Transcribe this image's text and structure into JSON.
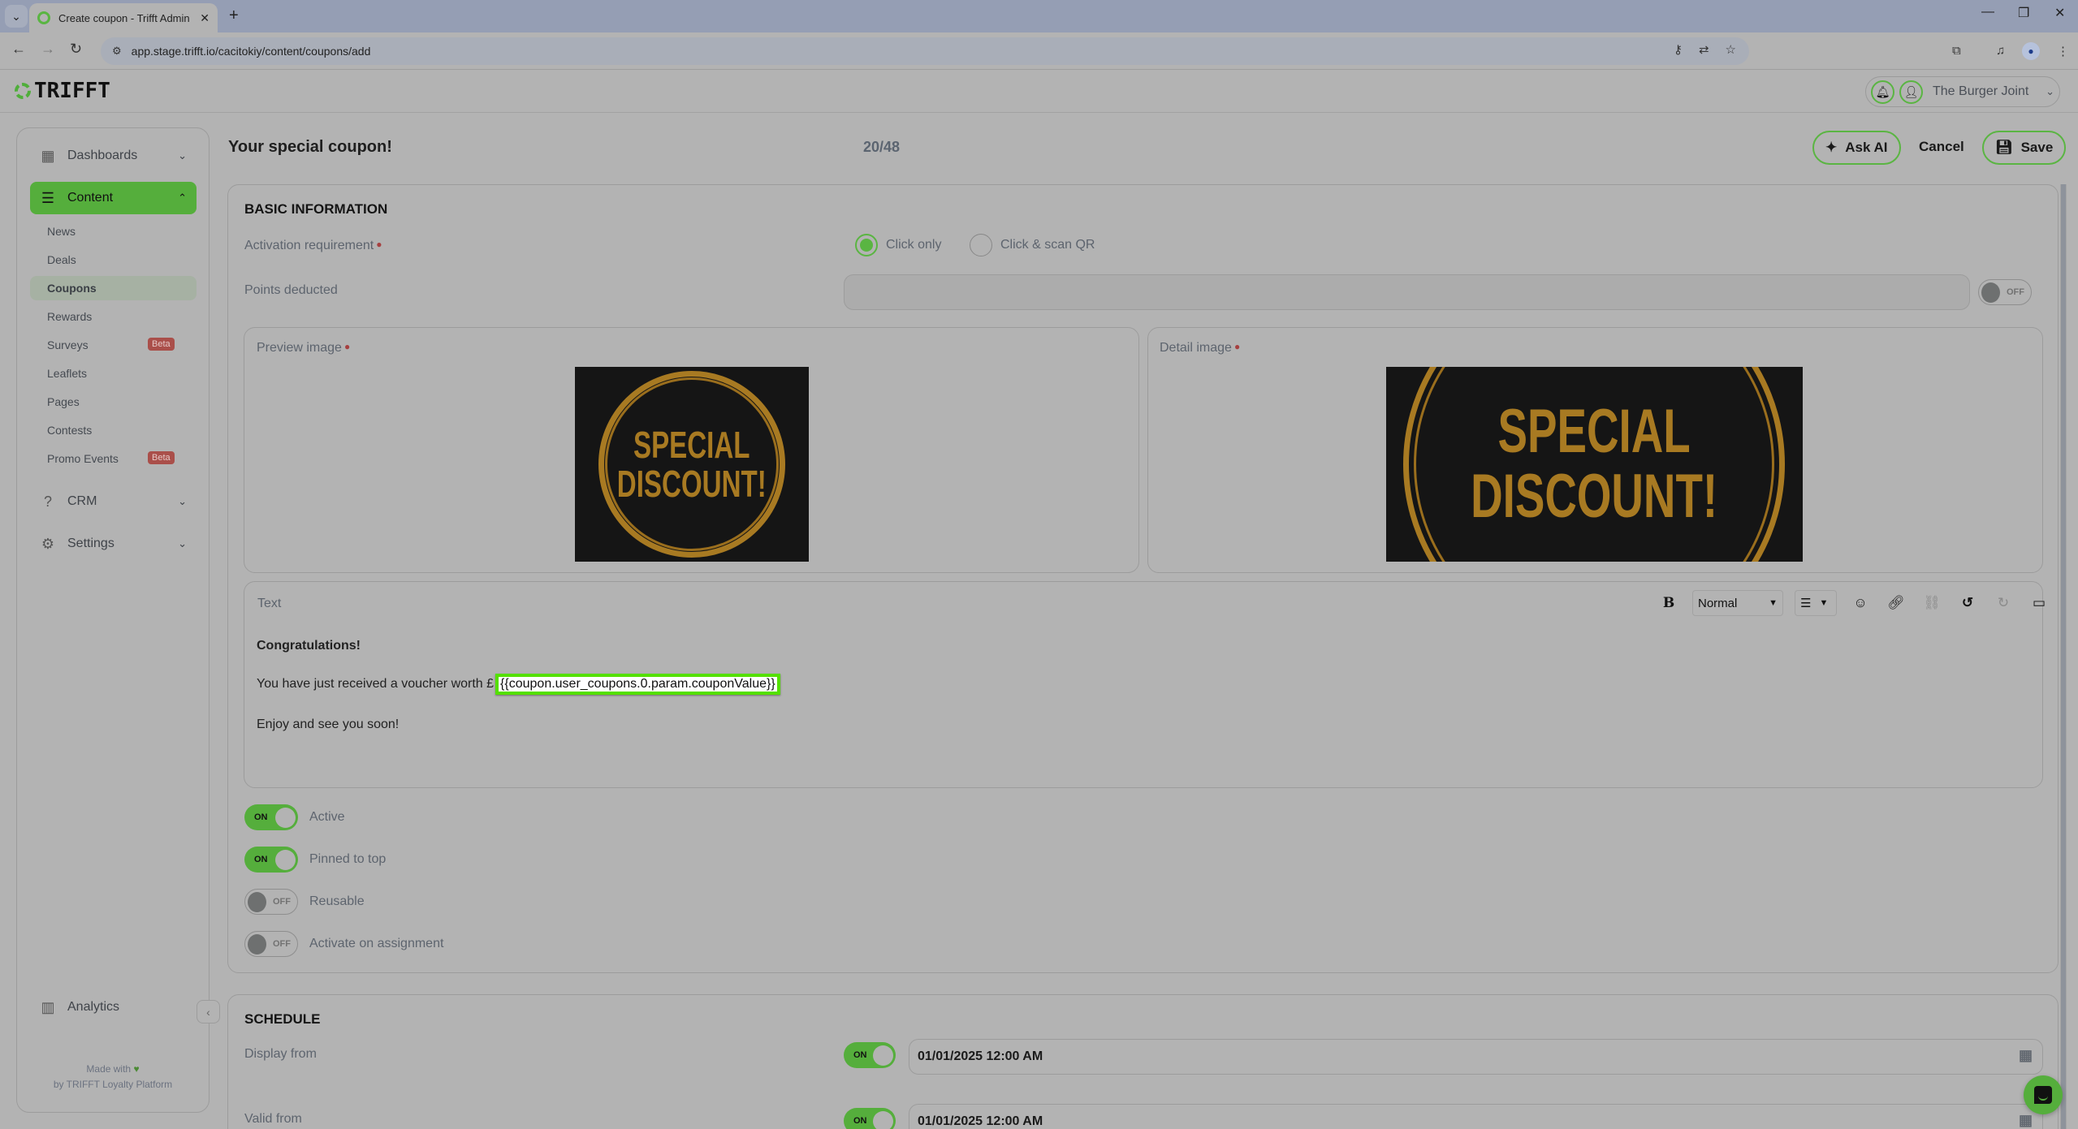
{
  "browser": {
    "tab_title": "Create coupon - Trifft Admin",
    "url": "app.stage.trifft.io/cacitokiy/content/coupons/add"
  },
  "header": {
    "logo_text": "TRIFFT",
    "account_name": "The Burger Joint"
  },
  "sidebar": {
    "groups": [
      {
        "label": "Dashboards",
        "icon": "dashboard-icon",
        "expanded": false
      },
      {
        "label": "Content",
        "icon": "document-icon",
        "expanded": true,
        "active": true
      },
      {
        "label": "CRM",
        "icon": "question-icon",
        "expanded": false
      },
      {
        "label": "Settings",
        "icon": "gear-icon",
        "expanded": false
      }
    ],
    "content_items": [
      {
        "label": "News"
      },
      {
        "label": "Deals"
      },
      {
        "label": "Coupons",
        "active": true
      },
      {
        "label": "Rewards"
      },
      {
        "label": "Surveys",
        "badge": "Beta"
      },
      {
        "label": "Leaflets"
      },
      {
        "label": "Pages"
      },
      {
        "label": "Contests"
      },
      {
        "label": "Promo Events",
        "badge": "Beta"
      }
    ],
    "analytics_label": "Analytics",
    "footer_line1": "Made with",
    "footer_line2": "by TRIFFT Loyalty Platform"
  },
  "page": {
    "title": "Your special coupon!",
    "title_count": "20/48",
    "ask_ai_label": "Ask AI",
    "cancel_label": "Cancel",
    "save_label": "Save"
  },
  "basic_info": {
    "section_title": "BASIC INFORMATION",
    "activation_label": "Activation requirement",
    "activation_options": [
      {
        "label": "Click only",
        "selected": true
      },
      {
        "label": "Click & scan QR",
        "selected": false
      }
    ],
    "points_label": "Points deducted",
    "points_value": "",
    "points_toggle": "OFF",
    "preview_image_label": "Preview image",
    "detail_image_label": "Detail image",
    "image_text_line1": "SPECIAL",
    "image_text_line2": "DISCOUNT!",
    "text_label": "Text",
    "editor": {
      "format_select": "Normal",
      "line1": "Congratulations!",
      "line2_prefix": "You have just received a voucher worth £",
      "line2_highlight": "{{coupon.user_coupons.0.param.couponValue}}",
      "line3": "Enjoy and see you soon!"
    },
    "toggles": [
      {
        "label": "Active",
        "state": "ON"
      },
      {
        "label": "Pinned to top",
        "state": "ON"
      },
      {
        "label": "Reusable",
        "state": "OFF"
      },
      {
        "label": "Activate on assignment",
        "state": "OFF"
      }
    ]
  },
  "schedule": {
    "section_title": "SCHEDULE",
    "rows": [
      {
        "label": "Display from",
        "toggle": "ON",
        "value": "01/01/2025 12:00 AM"
      },
      {
        "label": "Valid from",
        "toggle": "ON",
        "value": "01/01/2025 12:00 AM"
      }
    ]
  },
  "colors": {
    "brand_green": "#5ab542",
    "highlight_green": "#54e000",
    "beta_badge": "#aa4f4a"
  }
}
